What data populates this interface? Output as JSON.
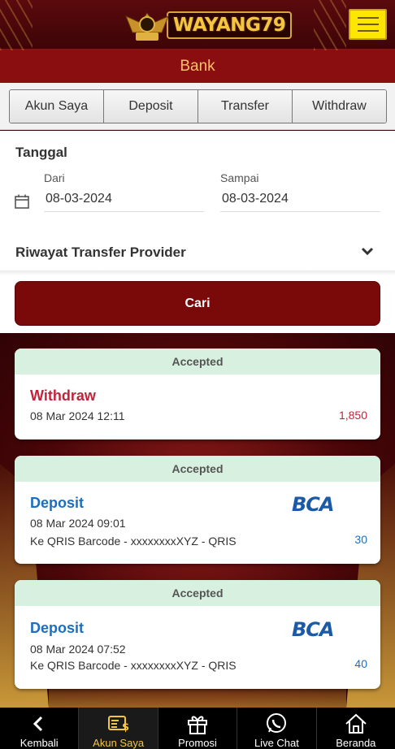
{
  "header": {
    "logo_text": "WAYANG79",
    "menu_icon": "hamburger-icon"
  },
  "page_title": "Bank",
  "tabs": [
    {
      "label": "Akun Saya"
    },
    {
      "label": "Deposit"
    },
    {
      "label": "Transfer"
    },
    {
      "label": "Withdraw"
    }
  ],
  "filter": {
    "tanggal_label": "Tanggal",
    "from_label": "Dari",
    "from_value": "08-03-2024",
    "to_label": "Sampai",
    "to_value": "08-03-2024",
    "provider_label": "Riwayat Transfer Provider",
    "search_button": "Cari"
  },
  "transactions": [
    {
      "status": "Accepted",
      "type": "Withdraw",
      "datetime": "08 Mar 2024 12:11",
      "description": "",
      "amount": "1,850",
      "bank_logo": ""
    },
    {
      "status": "Accepted",
      "type": "Deposit",
      "datetime": "08 Mar 2024 09:01",
      "description": "Ke QRIS Barcode - xxxxxxxxXYZ - QRIS",
      "amount": "30",
      "bank_logo": "BCA"
    },
    {
      "status": "Accepted",
      "type": "Deposit",
      "datetime": "08 Mar 2024 07:52",
      "description": "Ke QRIS Barcode - xxxxxxxxXYZ - QRIS",
      "amount": "40",
      "bank_logo": "BCA"
    }
  ],
  "bottom_nav": [
    {
      "label": "Kembali",
      "icon": "back-arrow-icon"
    },
    {
      "label": "Akun Saya",
      "icon": "account-money-icon",
      "active": true
    },
    {
      "label": "Promosi",
      "icon": "gift-icon"
    },
    {
      "label": "Live Chat",
      "icon": "whatsapp-icon"
    },
    {
      "label": "Beranda",
      "icon": "home-icon"
    }
  ],
  "colors": {
    "brand_red": "#8a0d10",
    "bank_title": "#ffc06a",
    "withdraw": "#c0243a",
    "deposit": "#1a6fc4",
    "accepted_bg": "#d8f0df",
    "menu_button": "#ffe600",
    "active_nav": "#f4c542"
  }
}
